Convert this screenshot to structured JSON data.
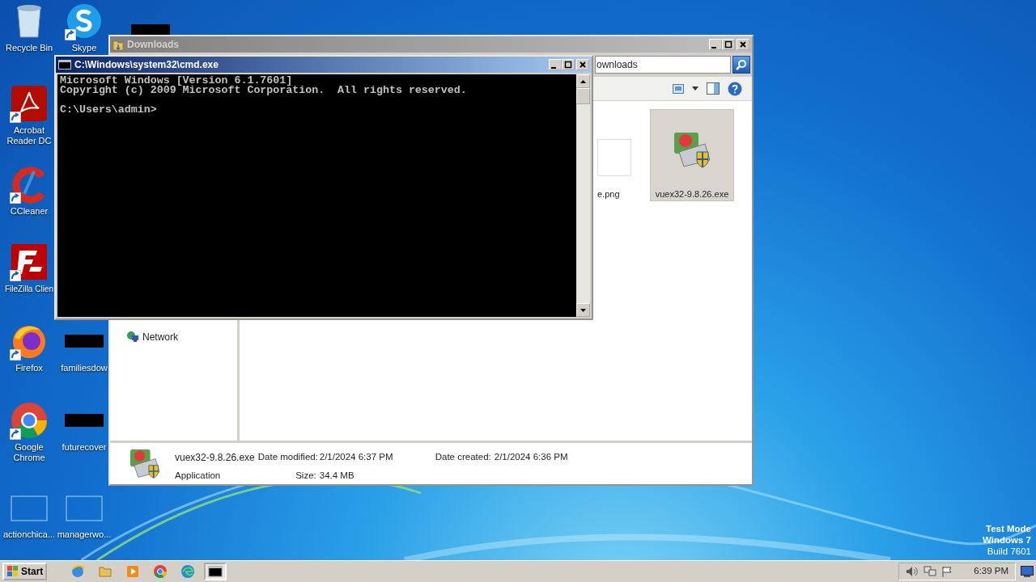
{
  "desktop_icons": [
    {
      "label": "Recycle Bin",
      "kind": "recycle",
      "shortcut": false
    },
    {
      "label": "Acrobat Reader DC",
      "kind": "acrobat",
      "shortcut": true
    },
    {
      "label": "CCleaner",
      "kind": "ccleaner",
      "shortcut": true
    },
    {
      "label": "FileZilla Clien",
      "kind": "filezilla",
      "shortcut": true
    },
    {
      "label": "Firefox",
      "kind": "firefox",
      "shortcut": true
    },
    {
      "label": "Google Chrome",
      "kind": "chrome",
      "shortcut": true
    },
    {
      "label": "actionchica...",
      "kind": "blank",
      "shortcut": false
    },
    {
      "label": "Skype",
      "kind": "skype",
      "shortcut": true
    },
    {
      "label": "familiesdow",
      "kind": "redacted",
      "shortcut": false
    },
    {
      "label": "futurecover",
      "kind": "redacted",
      "shortcut": false
    },
    {
      "label": "managerwo...",
      "kind": "blank",
      "shortcut": false
    },
    {
      "kind": "redacted"
    }
  ],
  "explorer": {
    "title": "Downloads",
    "active": false,
    "address": "ownloads",
    "files": [
      {
        "name": "e.png",
        "kind": "image",
        "selected": false
      },
      {
        "name": "vuex32-9.8.26.exe",
        "kind": "installer",
        "selected": true
      }
    ],
    "nav_items": [
      {
        "label": "Network"
      }
    ],
    "details": {
      "name": "vuex32-9.8.26.exe",
      "type": "Application",
      "modified_label": "Date modified:",
      "modified": "2/1/2024 6:37 PM",
      "size_label": "Size:",
      "size": "34.4 MB",
      "created_label": "Date created:",
      "created": "2/1/2024 6:36 PM"
    }
  },
  "cmd": {
    "title": "C:\\Windows\\system32\\cmd.exe",
    "active": true,
    "lines": [
      "Microsoft Windows [Version 6.1.7601]",
      "Copyright (c) 2009 Microsoft Corporation.  All rights reserved."
    ],
    "prompt": "C:\\Users\\admin>"
  },
  "taskbar": {
    "start": "Start",
    "apps": [
      {
        "kind": "ie",
        "active": false
      },
      {
        "kind": "folder",
        "active": false
      },
      {
        "kind": "media",
        "active": false
      },
      {
        "kind": "chrome",
        "active": false
      },
      {
        "kind": "edge",
        "active": false
      },
      {
        "kind": "console",
        "active": true
      }
    ],
    "clock": "6:39 PM"
  },
  "desktop_notice": [
    "Test Mode",
    "Windows 7",
    "Build 7601"
  ]
}
